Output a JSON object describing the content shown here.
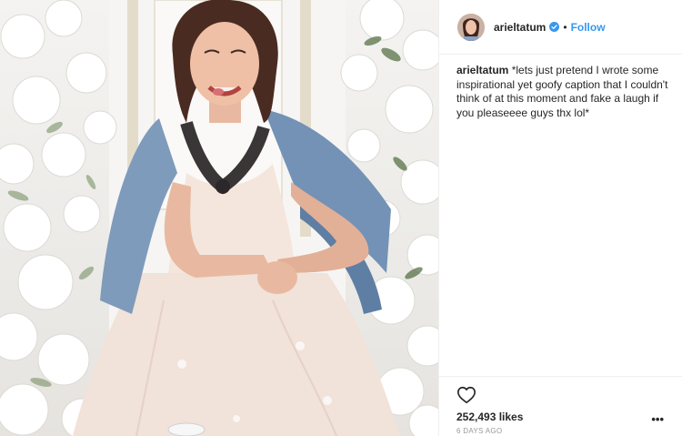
{
  "post": {
    "photo": {
      "alt": "Woman in denim jacket and blush tulle dress seated among white flowers"
    },
    "header": {
      "username": "arieltatum",
      "separator": "•",
      "follow_label": "Follow"
    },
    "caption": {
      "username": "arieltatum",
      "text": "*lets just pretend I wrote some inspirational yet goofy caption that I couldn't think of at this moment and fake a laugh if you pleaseeee guys thx lol*"
    },
    "footer": {
      "likes": "252,493 likes",
      "timestamp": "6 DAYS AGO",
      "more_label": "•••"
    },
    "colors": {
      "accent": "#3897f0",
      "text": "#262626",
      "muted": "#999999"
    }
  }
}
